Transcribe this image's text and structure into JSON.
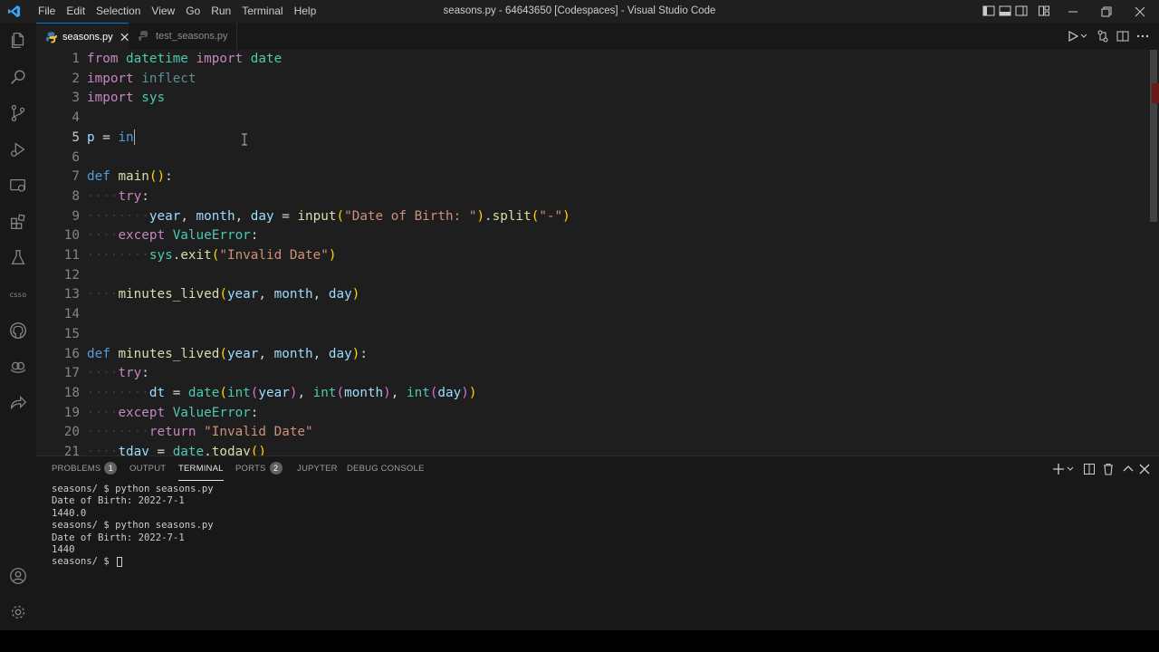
{
  "menu": [
    "File",
    "Edit",
    "Selection",
    "View",
    "Go",
    "Run",
    "Terminal",
    "Help"
  ],
  "window_title": "seasons.py - 64643650 [Codespaces] - Visual Studio Code",
  "activity": {
    "csso_label": "csso"
  },
  "tabs": [
    {
      "label": "seasons.py",
      "active": true
    },
    {
      "label": "test_seasons.py",
      "active": false
    }
  ],
  "editor": {
    "lines": [
      {
        "n": "1"
      },
      {
        "n": "2"
      },
      {
        "n": "3"
      },
      {
        "n": "4"
      },
      {
        "n": "5"
      },
      {
        "n": "6"
      },
      {
        "n": "7"
      },
      {
        "n": "8"
      },
      {
        "n": "9"
      },
      {
        "n": "10"
      },
      {
        "n": "11"
      },
      {
        "n": "12"
      },
      {
        "n": "13"
      },
      {
        "n": "14"
      },
      {
        "n": "15"
      },
      {
        "n": "16"
      },
      {
        "n": "17"
      },
      {
        "n": "18"
      },
      {
        "n": "19"
      },
      {
        "n": "20"
      },
      {
        "n": "21"
      }
    ],
    "code": {
      "from": "from",
      "datetime": "datetime",
      "import": "import",
      "date": "date",
      "inflect": "inflect",
      "sys": "sys",
      "p": "p",
      "eq": " = ",
      "in": "in",
      "def": "def",
      "main": "main",
      "try": "try",
      "year": "year",
      "month": "month",
      "day": "day",
      "input": "input",
      "dob_str": "\"Date of Birth: \"",
      "split": "split",
      "dash": "\"-\"",
      "except": "except",
      "ValueError": "ValueError",
      "exit": "exit",
      "invalid": "\"Invalid Date\"",
      "minutes_lived": "minutes_lived",
      "dt": "dt",
      "int": "int",
      "return": "return",
      "tday": "tdav",
      "today": "today"
    }
  },
  "panel": {
    "tabs": [
      {
        "label": "PROBLEMS",
        "badge": "1"
      },
      {
        "label": "OUTPUT"
      },
      {
        "label": "TERMINAL",
        "active": true
      },
      {
        "label": "PORTS",
        "badge": "2"
      },
      {
        "label": "JUPYTER"
      },
      {
        "label": "DEBUG CONSOLE"
      }
    ],
    "terminal_lines": [
      "seasons/ $ python seasons.py",
      "Date of Birth: 2022-7-1",
      "1440.0",
      "seasons/ $ python seasons.py",
      "Date of Birth: 2022-7-1",
      "1440",
      "seasons/ $ "
    ]
  }
}
